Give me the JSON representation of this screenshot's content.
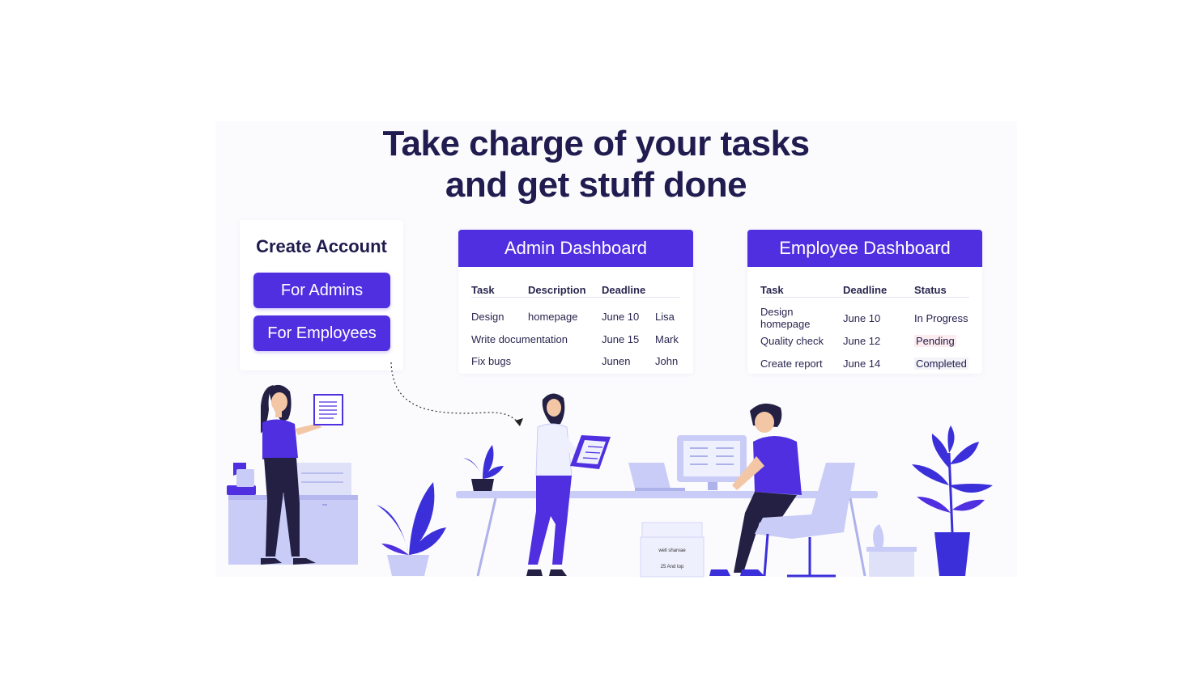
{
  "headline": {
    "line1": "Take charge of your tasks",
    "line2": "and get stuff done"
  },
  "create_account": {
    "title": "Create Account",
    "admins_button": "For Admins",
    "employees_button": "For Employees"
  },
  "admin_dashboard": {
    "title": "Admin Dashboard",
    "columns": [
      "Task",
      "Description",
      "Deadline",
      ""
    ],
    "rows": [
      [
        "Design",
        "homepage",
        "June 10",
        "Lisa"
      ],
      [
        "Write documentation",
        "",
        "June 15",
        "Mark"
      ],
      [
        "Fix bugs",
        "",
        "Junen",
        "John"
      ]
    ]
  },
  "employee_dashboard": {
    "title": "Employee Dashboard",
    "columns": [
      "Task",
      "Deadline",
      "Status"
    ],
    "rows": [
      [
        "Design homepage",
        "June 10",
        "In Progress"
      ],
      [
        "Quality check",
        "June 12",
        "Pending"
      ],
      [
        "Create report",
        "June 14",
        "Completed"
      ]
    ]
  },
  "illustration": {
    "box_label_1": "well sharvae",
    "box_label_2": "25 And top"
  },
  "colors": {
    "accent": "#4f2fe0",
    "accent_light": "#c9ccf6",
    "text_dark": "#201c4f",
    "plant": "#3b2fd9"
  }
}
